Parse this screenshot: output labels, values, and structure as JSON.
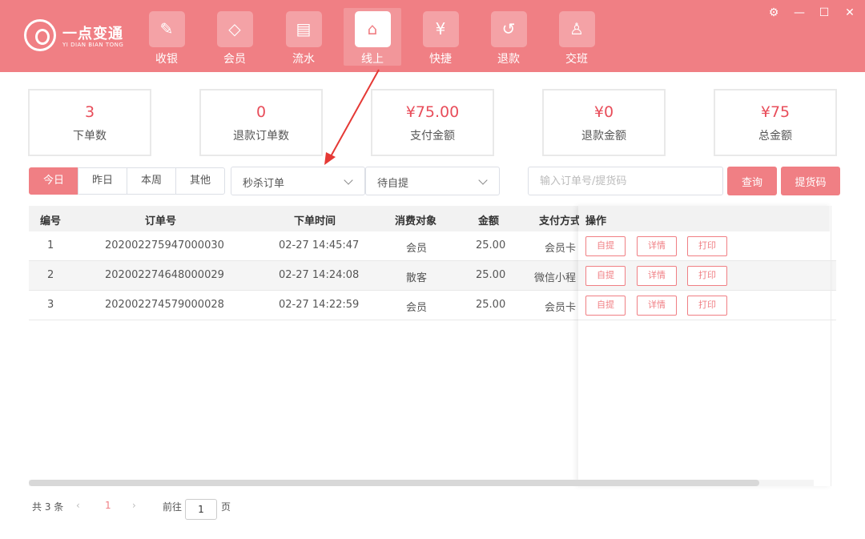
{
  "brand": {
    "name": "一点变通",
    "subtitle": "YI DIAN BIAN TONG"
  },
  "nav": [
    {
      "label": "收银",
      "icon": "pen-edit-icon",
      "glyph": "✎"
    },
    {
      "label": "会员",
      "icon": "diamond-icon",
      "glyph": "◇"
    },
    {
      "label": "流水",
      "icon": "document-icon",
      "glyph": "▤"
    },
    {
      "label": "线上",
      "icon": "store-icon",
      "glyph": "⌂",
      "active": true
    },
    {
      "label": "快捷",
      "icon": "yen-receipt-icon",
      "glyph": "¥"
    },
    {
      "label": "退款",
      "icon": "refund-icon",
      "glyph": "↺"
    },
    {
      "label": "交班",
      "icon": "user-handover-icon",
      "glyph": "♙"
    }
  ],
  "window_controls": {
    "settings": "⚙",
    "minimize": "—",
    "maximize": "☐",
    "close": "✕"
  },
  "stats": [
    {
      "value": "3",
      "label": "下单数"
    },
    {
      "value": "0",
      "label": "退款订单数"
    },
    {
      "value": "¥75.00",
      "label": "支付金额"
    },
    {
      "value": "¥0",
      "label": "退款金额"
    },
    {
      "value": "¥75",
      "label": "总金额"
    }
  ],
  "date_filters": [
    {
      "label": "今日",
      "active": true
    },
    {
      "label": "昨日"
    },
    {
      "label": "本周"
    },
    {
      "label": "其他"
    }
  ],
  "order_type_select": {
    "value": "秒杀订单"
  },
  "status_select": {
    "value": "待自提"
  },
  "search": {
    "placeholder": "输入订单号/提货码",
    "value": ""
  },
  "buttons": {
    "query": "查询",
    "pickup_code": "提货码"
  },
  "table": {
    "headers": {
      "index": "编号",
      "order_no": "订单号",
      "time": "下单时间",
      "target": "消费对象",
      "amount": "金额",
      "pay_method": "支付方式",
      "actions": "操作"
    },
    "rows": [
      {
        "index": "1",
        "order_no": "202002275947000030",
        "time": "02-27 14:45:47",
        "target": "会员",
        "amount": "25.00",
        "pay_method": "会员卡"
      },
      {
        "index": "2",
        "order_no": "202002274648000029",
        "time": "02-27 14:24:08",
        "target": "散客",
        "amount": "25.00",
        "pay_method": "微信小程"
      },
      {
        "index": "3",
        "order_no": "202002274579000028",
        "time": "02-27 14:22:59",
        "target": "会员",
        "amount": "25.00",
        "pay_method": "会员卡"
      }
    ],
    "row_actions": {
      "pickup": "自提",
      "detail": "详情",
      "print": "打印"
    }
  },
  "pagination": {
    "total": "共 3 条",
    "prev": "‹",
    "current": "1",
    "next": "›",
    "goto_label": "前往",
    "goto_value": "1",
    "page_suffix": "页"
  },
  "colors": {
    "brand": "#f07f84",
    "value_red": "#e84d5a",
    "annotation": "#e53935"
  }
}
